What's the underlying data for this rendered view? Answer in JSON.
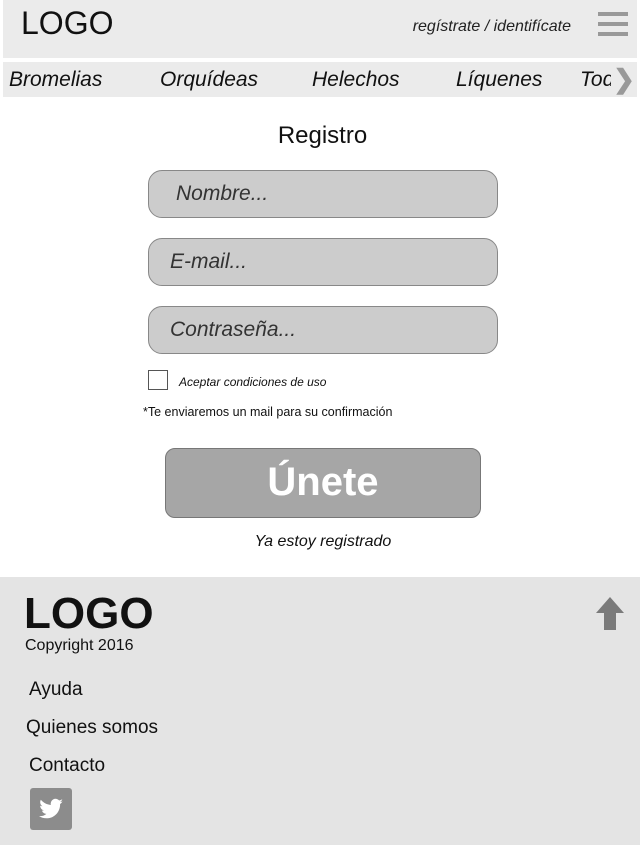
{
  "header": {
    "logo": "LOGO",
    "auth_link": "regístrate / identifícate",
    "menu_icon": "hamburger-menu-icon"
  },
  "nav": {
    "items": [
      "Bromelias",
      "Orquídeas",
      "Helechos",
      "Líquenes",
      "Todos"
    ],
    "arrow_icon": "chevron-right-icon"
  },
  "form": {
    "title": "Registro",
    "name_placeholder": "Nombre...",
    "email_placeholder": "E-mail...",
    "password_placeholder": "Contraseña...",
    "terms_label": "Aceptar condiciones de uso",
    "terms_checked": false,
    "note": "*Te enviaremos un mail para su confirmación",
    "submit_label": "Únete",
    "login_link": "Ya estoy registrado"
  },
  "footer": {
    "logo": "LOGO",
    "copyright": "Copyright 2016",
    "links": [
      "Ayuda",
      "Quienes somos",
      "Contacto"
    ],
    "social_icon": "twitter-icon",
    "up_icon": "arrow-up-icon"
  },
  "colors": {
    "bar_background": "#ebebeb",
    "footer_background": "#e4e4e4",
    "field_fill": "#cccccc",
    "button_fill": "#a6a6a6"
  }
}
